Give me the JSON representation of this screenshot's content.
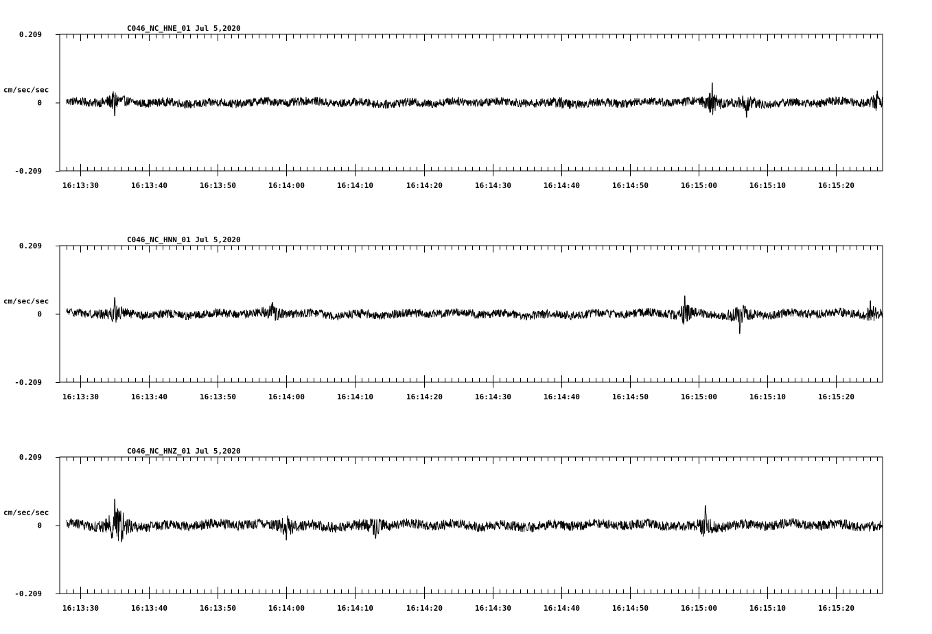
{
  "chart_data": [
    {
      "type": "line",
      "title": "C046_NC_HNE_01   Jul 5,2020",
      "ylabel": "cm/sec/sec",
      "ylim": [
        -0.209,
        0.209
      ],
      "y_ticks": [
        "0.209",
        "0",
        "-0.209"
      ],
      "xlim": [
        "16:13:27",
        "16:15:27"
      ],
      "x_ticks": [
        "16:13:30",
        "16:13:40",
        "16:13:50",
        "16:14:00",
        "16:14:10",
        "16:14:20",
        "16:14:30",
        "16:14:40",
        "16:14:50",
        "16:15:00",
        "16:15:10",
        "16:15:20"
      ],
      "noise_amplitude": 0.013,
      "events": [
        {
          "t": "16:13:35",
          "peak": -0.04
        },
        {
          "t": "16:14:40",
          "peak": 0.015
        },
        {
          "t": "16:15:02",
          "peak": 0.06
        },
        {
          "t": "16:15:07",
          "peak": -0.045
        },
        {
          "t": "16:15:26",
          "peak": 0.035
        }
      ]
    },
    {
      "type": "line",
      "title": "C046_NC_HNN_01   Jul 5,2020",
      "ylabel": "cm/sec/sec",
      "ylim": [
        -0.209,
        0.209
      ],
      "y_ticks": [
        "0.209",
        "0",
        "-0.209"
      ],
      "xlim": [
        "16:13:27",
        "16:15:27"
      ],
      "x_ticks": [
        "16:13:30",
        "16:13:40",
        "16:13:50",
        "16:14:00",
        "16:14:10",
        "16:14:20",
        "16:14:30",
        "16:14:40",
        "16:14:50",
        "16:15:00",
        "16:15:10",
        "16:15:20"
      ],
      "noise_amplitude": 0.013,
      "events": [
        {
          "t": "16:13:35",
          "peak": 0.05
        },
        {
          "t": "16:13:58",
          "peak": 0.035
        },
        {
          "t": "16:14:58",
          "peak": 0.055
        },
        {
          "t": "16:15:06",
          "peak": -0.06
        },
        {
          "t": "16:15:25",
          "peak": 0.04
        }
      ]
    },
    {
      "type": "line",
      "title": "C046_NC_HNZ_01   Jul 5,2020",
      "ylabel": "cm/sec/sec",
      "ylim": [
        -0.209,
        0.209
      ],
      "y_ticks": [
        "0.209",
        "0",
        "-0.209"
      ],
      "xlim": [
        "16:13:27",
        "16:15:27"
      ],
      "x_ticks": [
        "16:13:30",
        "16:13:40",
        "16:13:50",
        "16:14:00",
        "16:14:10",
        "16:14:20",
        "16:14:30",
        "16:14:40",
        "16:14:50",
        "16:15:00",
        "16:15:10",
        "16:15:20"
      ],
      "noise_amplitude": 0.015,
      "events": [
        {
          "t": "16:13:35",
          "peak": 0.08
        },
        {
          "t": "16:13:36",
          "peak": -0.05
        },
        {
          "t": "16:14:00",
          "peak": -0.045
        },
        {
          "t": "16:14:13",
          "peak": -0.04
        },
        {
          "t": "16:15:01",
          "peak": 0.06
        }
      ]
    }
  ]
}
